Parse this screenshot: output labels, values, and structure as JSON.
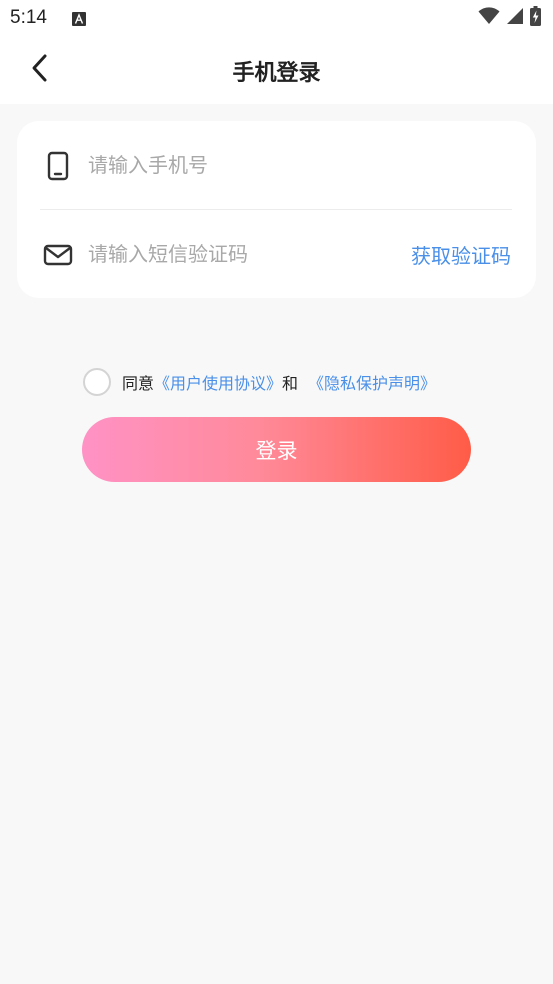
{
  "status_bar": {
    "time": "5:14",
    "app_icon": "a-letter-icon",
    "wifi_icon": "wifi-icon",
    "signal_icon": "signal-icon",
    "battery_icon": "battery-charging-icon"
  },
  "header": {
    "back_icon": "chevron-left-icon",
    "title": "手机登录"
  },
  "form": {
    "phone": {
      "icon": "phone-icon",
      "value": "",
      "placeholder": "请输入手机号"
    },
    "code": {
      "icon": "mail-icon",
      "value": "",
      "placeholder": "请输入短信验证码",
      "get_code_label": "获取验证码"
    }
  },
  "agreement": {
    "checked": false,
    "prefix": "同意",
    "user_agreement": "《用户使用协议》",
    "connector": "和",
    "privacy_policy": "《隐私保护声明》"
  },
  "login_button": {
    "label": "登录"
  },
  "colors": {
    "link": "#4a8fe8",
    "gradient_start": "#ff92c5",
    "gradient_end": "#ff5c47",
    "background": "#f8f8f8"
  }
}
